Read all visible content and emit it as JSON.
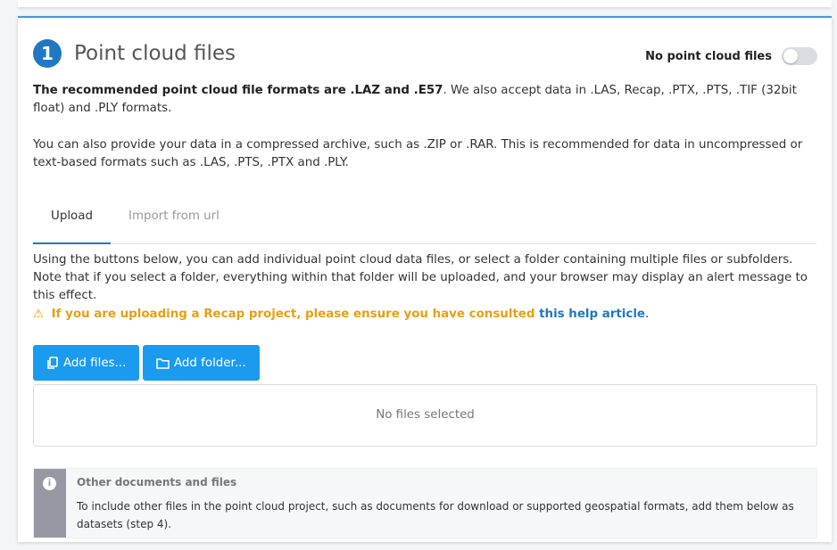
{
  "section": {
    "step_number": "1",
    "title": "Point cloud files",
    "toggle_label": "No point cloud files",
    "toggle_on": false
  },
  "intro": {
    "bold": "The recommended point cloud file formats are .LAZ and .E57",
    "rest": ". We also accept data in .LAS, Recap, .PTX, .PTS, .TIF (32bit float) and .PLY formats.",
    "archive": "You can also provide your data in a compressed archive, such as .ZIP or .RAR. This is recommended for data in uncompressed or text-based formats such as .LAS, .PTS, .PTX and .PLY."
  },
  "tabs": [
    {
      "label": "Upload",
      "active": true
    },
    {
      "label": "Import from url",
      "active": false
    }
  ],
  "upload": {
    "instructions": "Using the buttons below, you can add individual point cloud data files, or select a folder containing multiple files or subfolders. Note that if you select a folder, everything within that folder will be uploaded, and your browser may display an alert message to this effect.",
    "warning_icon": "⚠",
    "warning_text": "If you are uploading a Recap project, please ensure you have consulted ",
    "warning_link": "this help article",
    "warning_end": ".",
    "add_files_label": "Add files...",
    "add_folder_label": "Add folder...",
    "empty_text": "No files selected"
  },
  "info_box": {
    "icon": "i",
    "title": "Other documents and files",
    "text": "To include other files in the point cloud project, such as documents for download or supported geospatial formats, add them below as datasets (step 4)."
  },
  "colors": {
    "accent": "#1f78c1",
    "button": "#1a9bf0",
    "warning": "#e6a013",
    "info_side": "#9898a4"
  }
}
